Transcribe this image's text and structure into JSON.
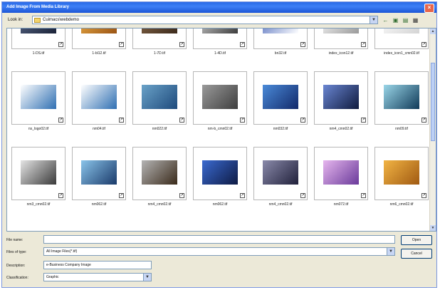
{
  "window": {
    "title": "Add Image From Media Library",
    "close_label": "×"
  },
  "toolbar": {
    "look_in_label": "Look in:",
    "look_in_value": "Cuimacs\\webdemo",
    "buttons": [
      "back-icon",
      "up-folder-icon",
      "new-folder-icon",
      "views-menu-icon"
    ]
  },
  "files": [
    {
      "name": "1-DS.tif",
      "icon": "lightning-thumbnail",
      "colors": [
        "#5a6a8a",
        "#1b2338"
      ]
    },
    {
      "name": "1-bl12.tif",
      "icon": "amber-abstract-thumbnail",
      "colors": [
        "#f1b34a",
        "#9a5414"
      ]
    },
    {
      "name": "1-7D.tif",
      "icon": "bronze-texture-thumbnail",
      "colors": [
        "#8a6a4a",
        "#3c2a1c"
      ]
    },
    {
      "name": "1-4D.tif",
      "icon": "metal-grid-thumbnail",
      "colors": [
        "#d7d7d7",
        "#3c3c3c"
      ]
    },
    {
      "name": "bn32.tif",
      "icon": "blue-banner-thumbnail",
      "colors": [
        "#3e5db5",
        "#ffffff"
      ]
    },
    {
      "name": "index_icon12.tif",
      "icon": "company-logo-thumbnail",
      "colors": [
        "#ffffff",
        "#9a9a9a"
      ]
    },
    {
      "name": "index_icon1_cmn02.tif",
      "icon": "faint-logo-thumbnail",
      "colors": [
        "#ffffff",
        "#d4d4d4"
      ]
    },
    {
      "name": "ns_logo02.tif",
      "icon": "swirl-logo-thumbnail",
      "colors": [
        "#ffffff",
        "#2f6fb2"
      ]
    },
    {
      "name": "nm04.tif",
      "icon": "swirl-logo-thumbnail",
      "colors": [
        "#ffffff",
        "#2f6fb2"
      ]
    },
    {
      "name": "nm022.tif",
      "icon": "blue-mesh-thumbnail",
      "colors": [
        "#6aa2c8",
        "#1e4a7c"
      ]
    },
    {
      "name": "nm-b_cmn02.tif",
      "icon": "gray-mesh-thumbnail",
      "colors": [
        "#9a9a9a",
        "#3e3e3e"
      ]
    },
    {
      "name": "nm032.tif",
      "icon": "blue-glow-thumbnail",
      "colors": [
        "#4a8ad8",
        "#12296a"
      ]
    },
    {
      "name": "nm4_cmn02.tif",
      "icon": "blue-blur-thumbnail",
      "colors": [
        "#6a86d2",
        "#0f1a3e"
      ]
    },
    {
      "name": "nm09.tif",
      "icon": "speaker-thumbnail",
      "colors": [
        "#9ad6e8",
        "#103a58"
      ]
    },
    {
      "name": "nm3_cmn02.tif",
      "icon": "lens-thumbnail",
      "colors": [
        "#e4e4e4",
        "#3a3a3a"
      ]
    },
    {
      "name": "nm062.tif",
      "icon": "pen-thumbnail",
      "colors": [
        "#8ac4ea",
        "#1a3a6a"
      ]
    },
    {
      "name": "nm4_cmn02.tif",
      "icon": "pen-thumbnail",
      "colors": [
        "#b4b4b4",
        "#3a2a1a"
      ]
    },
    {
      "name": "nm062.tif",
      "icon": "lightning-thumbnail",
      "colors": [
        "#3a6ad0",
        "#0e1a44"
      ]
    },
    {
      "name": "nm4_cmn02.tif",
      "icon": "lightning-thumbnail",
      "colors": [
        "#8a8aaa",
        "#20203a"
      ]
    },
    {
      "name": "nm072.tif",
      "icon": "purple-glow-thumbnail",
      "colors": [
        "#e6b6ee",
        "#6a3a9a"
      ]
    },
    {
      "name": "nm6_cmn02.tif",
      "icon": "amber-abstract-thumbnail",
      "colors": [
        "#f2b444",
        "#a05a12"
      ]
    }
  ],
  "form": {
    "file_name_label": "File name:",
    "file_name_value": "",
    "files_of_type_label": "Files of type:",
    "files_of_type_value": "All Image Files(*.tif)",
    "description_label": "Description:",
    "description_value": "e-Business Company Image",
    "classification_label": "Classification:",
    "classification_value": "Graphic",
    "open_button": "Open",
    "cancel_button": "Cancel"
  }
}
